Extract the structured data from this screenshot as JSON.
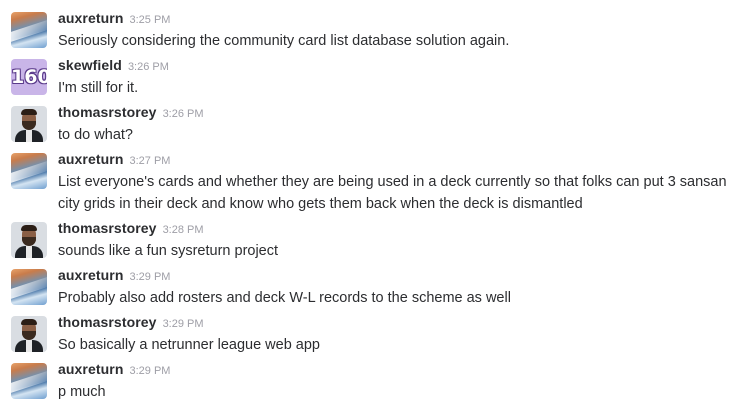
{
  "messages": [
    {
      "user": "auxreturn",
      "time": "3:25 PM",
      "text": "Seriously considering the community card list database solution again.",
      "avatar": "auxreturn"
    },
    {
      "user": "skewfield",
      "time": "3:26 PM",
      "text": "I'm still for it.",
      "avatar": "skewfield",
      "avatar_text": "160"
    },
    {
      "user": "thomasrstorey",
      "time": "3:26 PM",
      "text": "to do what?",
      "avatar": "thomasrstorey"
    },
    {
      "user": "auxreturn",
      "time": "3:27 PM",
      "text": "List everyone's cards and whether they are being used in a deck currently so that folks can put 3 sansan city grids in their deck and know who gets them back when the deck is dismantled",
      "avatar": "auxreturn"
    },
    {
      "user": "thomasrstorey",
      "time": "3:28 PM",
      "text": "sounds like a fun sysreturn project",
      "avatar": "thomasrstorey"
    },
    {
      "user": "auxreturn",
      "time": "3:29 PM",
      "text": "Probably also add rosters and deck W-L records to the scheme as well",
      "avatar": "auxreturn"
    },
    {
      "user": "thomasrstorey",
      "time": "3:29 PM",
      "text": "So basically a netrunner league web app",
      "avatar": "thomasrstorey"
    },
    {
      "user": "auxreturn",
      "time": "3:29 PM",
      "text": "p much",
      "avatar": "auxreturn"
    }
  ]
}
